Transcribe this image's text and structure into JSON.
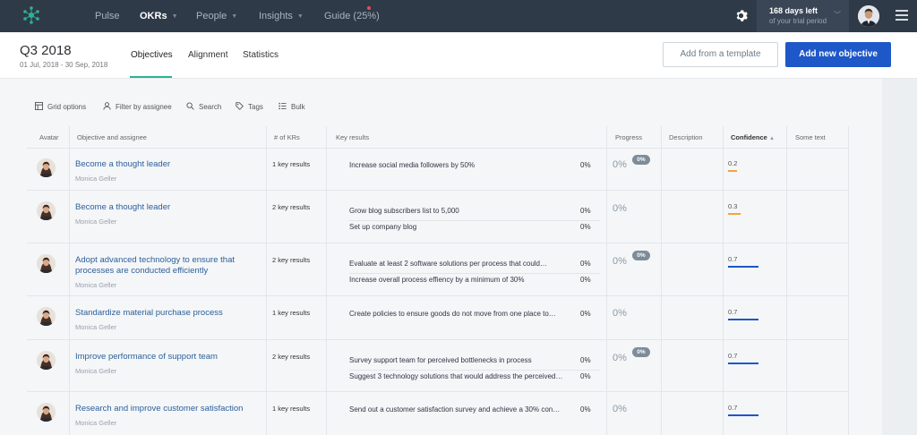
{
  "nav": {
    "items": [
      {
        "label": "Pulse",
        "active": false,
        "caret": false
      },
      {
        "label": "OKRs",
        "active": true,
        "caret": true
      },
      {
        "label": "People",
        "active": false,
        "caret": true
      },
      {
        "label": "Insights",
        "active": false,
        "caret": true
      },
      {
        "label": "Guide (25%)",
        "active": false,
        "caret": false
      }
    ],
    "trial_title": "168 days left",
    "trial_sub": "of your trial period"
  },
  "header": {
    "quarter": "Q3 2018",
    "date_range": "01 Jul, 2018 - 30 Sep, 2018",
    "tabs": [
      "Objectives",
      "Alignment",
      "Statistics"
    ],
    "active_tab": "Objectives",
    "template_button": "Add from a template",
    "add_button": "Add new objective"
  },
  "toolbar": {
    "grid_options": "Grid options",
    "filter": "Filter by assignee",
    "search": "Search",
    "tags": "Tags",
    "bulk": "Bulk"
  },
  "columns": {
    "avatar": "Avatar",
    "objective": "Objective and assignee",
    "krs": "# of KRs",
    "key_results": "Key results",
    "progress": "Progress",
    "description": "Description",
    "confidence": "Confidence",
    "some_text": "Some text"
  },
  "colors": {
    "nav_bg": "#2f3a48",
    "primary_button": "#1e57c7",
    "tab_accent": "#2db38f",
    "link": "#2d5f9a",
    "confidence_low": "#f0a542",
    "confidence_high": "#1e57c7",
    "badge": "#7e8c99"
  },
  "rows": [
    {
      "title": "Become a thought leader",
      "owner": "Monica Geller",
      "kr_count": "1 key results",
      "key_results": [
        {
          "text": "Increase social media followers by 50%",
          "pct": "0%"
        }
      ],
      "progress": "0%",
      "badge": "0%",
      "confidence": "0.2",
      "confidence_level": 0.2
    },
    {
      "title": "Become a thought leader",
      "owner": "Monica Geller",
      "kr_count": "2 key results",
      "key_results": [
        {
          "text": "Grow blog subscribers list to 5,000",
          "pct": "0%"
        },
        {
          "text": "Set up company blog",
          "pct": "0%"
        }
      ],
      "progress": "0%",
      "badge": "",
      "confidence": "0.3",
      "confidence_level": 0.3
    },
    {
      "title": "Adopt advanced technology to ensure that processes are conducted efficiently",
      "owner": "Monica Geller",
      "kr_count": "2 key results",
      "key_results": [
        {
          "text": "Evaluate at least 2 software solutions per process that could…",
          "pct": "0%"
        },
        {
          "text": "Increase overall process effiency by a minimum of 30%",
          "pct": "0%"
        }
      ],
      "progress": "0%",
      "badge": "0%",
      "confidence": "0.7",
      "confidence_level": 0.7
    },
    {
      "title": "Standardize material purchase process",
      "owner": "Monica Geller",
      "kr_count": "1 key results",
      "key_results": [
        {
          "text": "Create policies to ensure goods do not move from one place to…",
          "pct": "0%"
        }
      ],
      "progress": "0%",
      "badge": "",
      "confidence": "0.7",
      "confidence_level": 0.7
    },
    {
      "title": "Improve performance of support team",
      "owner": "Monica Geller",
      "kr_count": "2 key results",
      "key_results": [
        {
          "text": "Survey support team for perceived bottlenecks in process",
          "pct": "0%"
        },
        {
          "text": "Suggest 3 technology solutions that would address the perceived…",
          "pct": "0%"
        }
      ],
      "progress": "0%",
      "badge": "0%",
      "confidence": "0.7",
      "confidence_level": 0.7
    },
    {
      "title": "Research and improve customer satisfaction",
      "owner": "Monica Geller",
      "kr_count": "1 key results",
      "key_results": [
        {
          "text": "Send out a customer satisfaction survey and achieve a 30% con…",
          "pct": "0%"
        }
      ],
      "progress": "0%",
      "badge": "",
      "confidence": "0.7",
      "confidence_level": 0.7
    }
  ]
}
